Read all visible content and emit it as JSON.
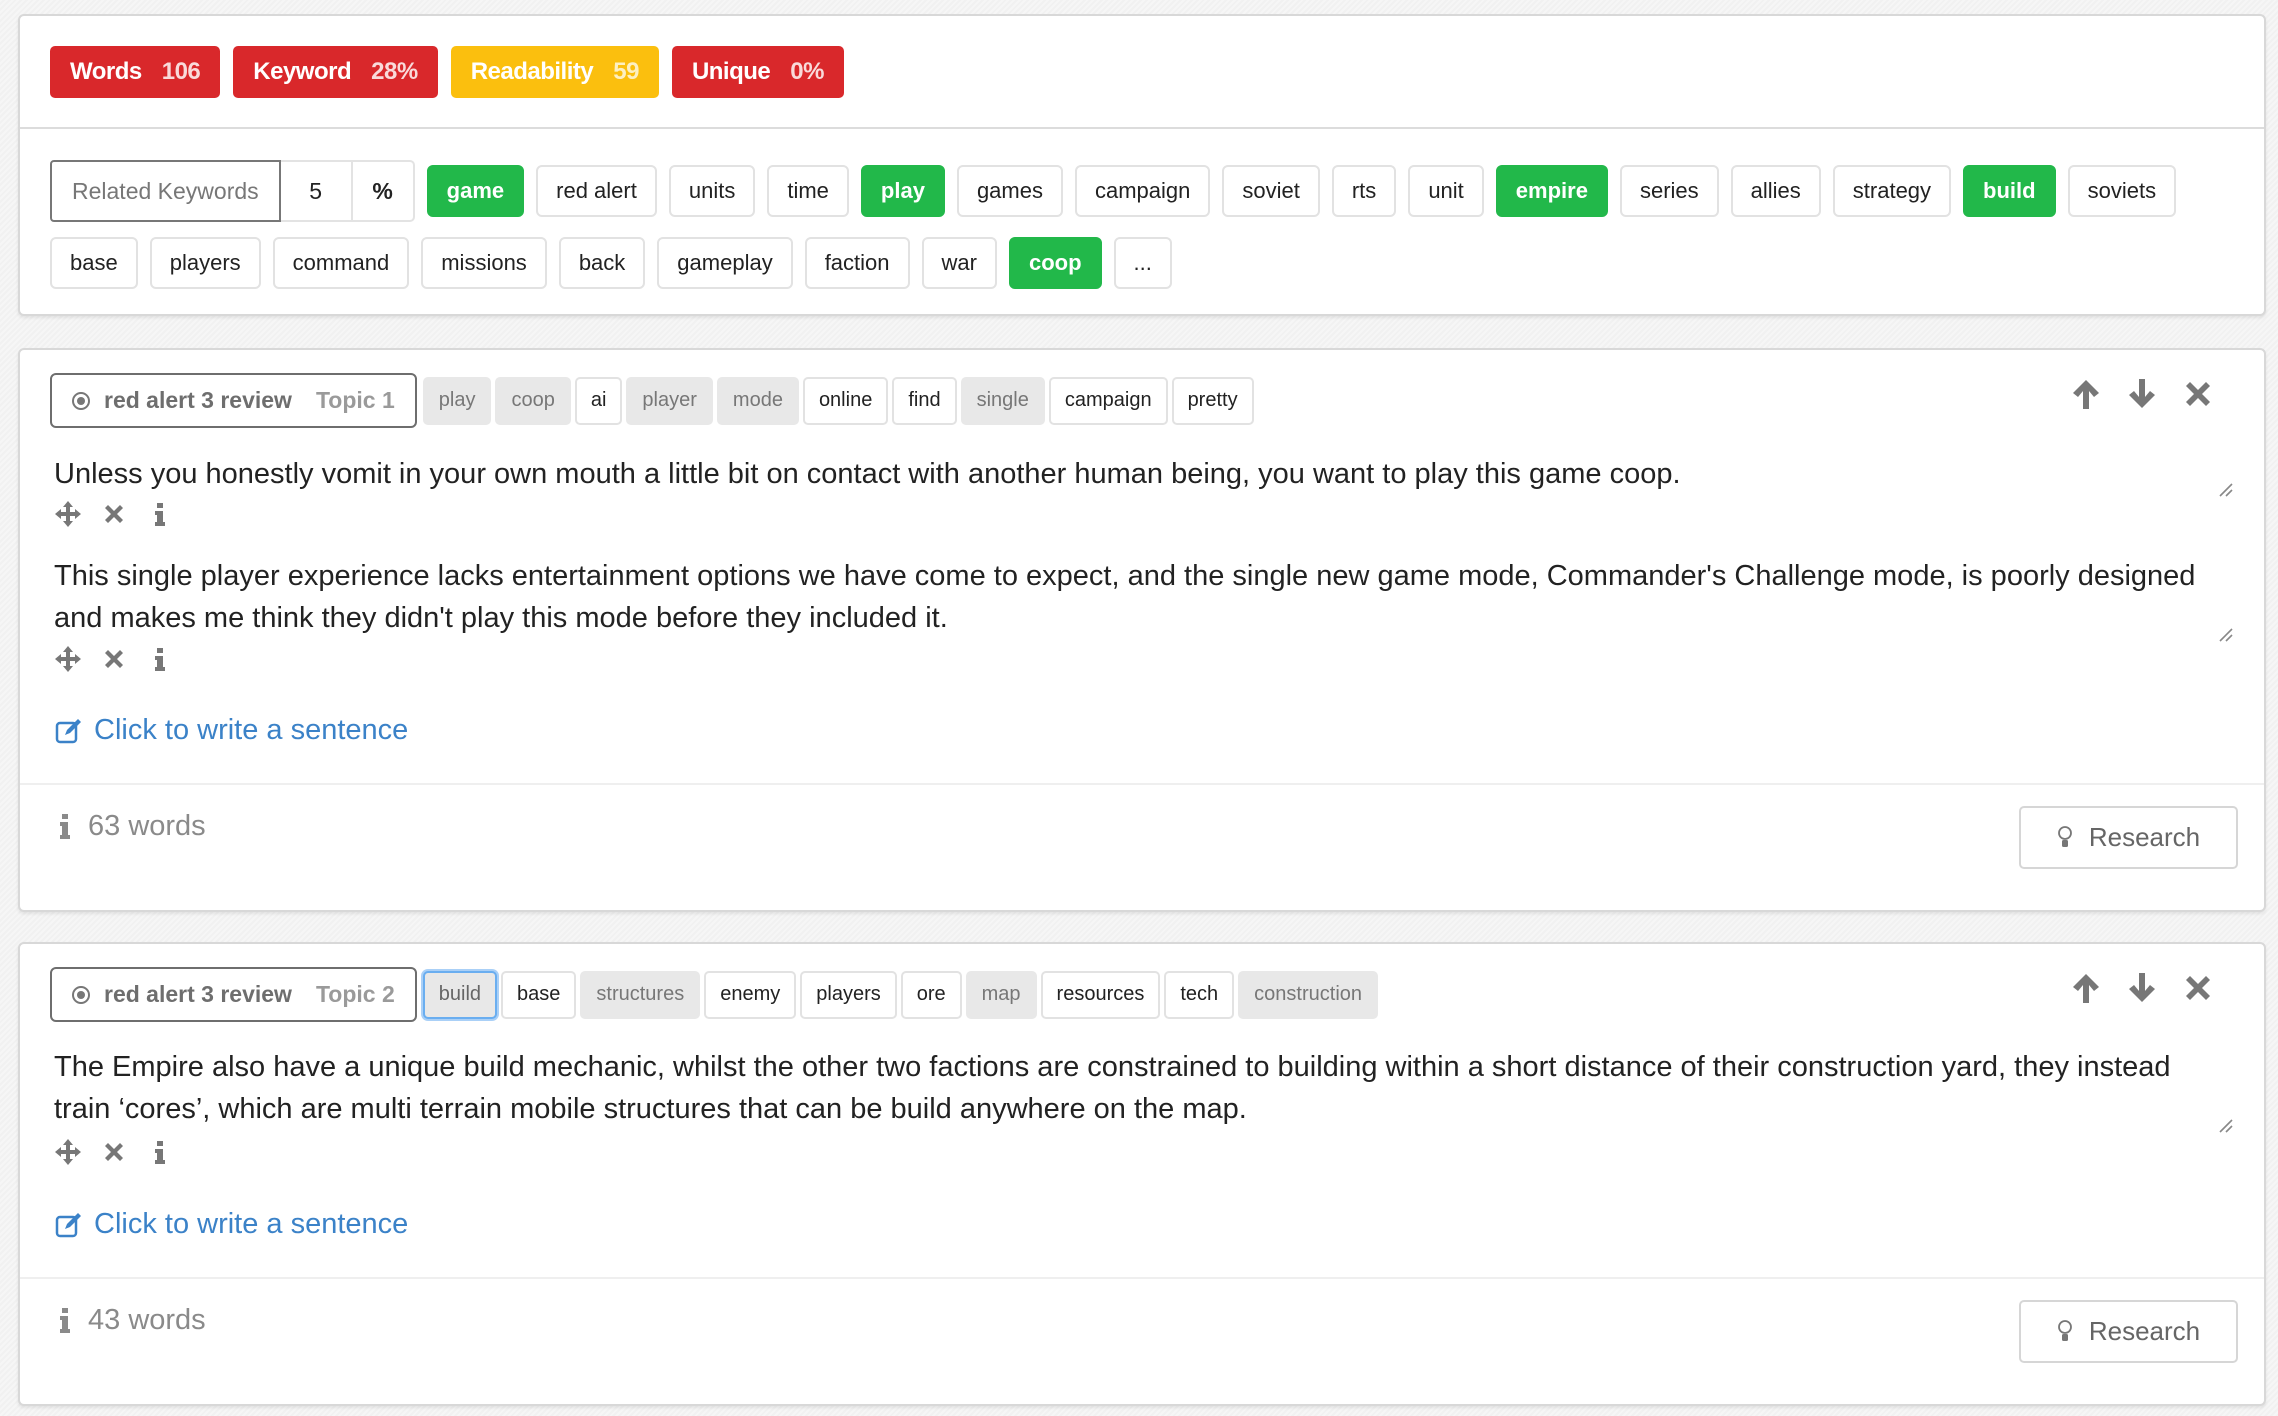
{
  "stats": {
    "badges": [
      {
        "label": "Words",
        "value": "106",
        "status": "red"
      },
      {
        "label": "Keyword",
        "value": "28%",
        "status": "red"
      },
      {
        "label": "Readability",
        "value": "59",
        "status": "yellow"
      },
      {
        "label": "Unique",
        "value": "0%",
        "status": "red"
      }
    ]
  },
  "related_keywords": {
    "label": "Related Keywords",
    "count": "5",
    "unit": "%",
    "rows": [
      [
        {
          "text": "game",
          "active": true
        },
        {
          "text": "red alert",
          "active": false
        },
        {
          "text": "units",
          "active": false
        },
        {
          "text": "time",
          "active": false
        },
        {
          "text": "play",
          "active": true
        },
        {
          "text": "games",
          "active": false
        },
        {
          "text": "campaign",
          "active": false
        },
        {
          "text": "soviet",
          "active": false
        },
        {
          "text": "rts",
          "active": false
        },
        {
          "text": "unit",
          "active": false
        },
        {
          "text": "empire",
          "active": true
        },
        {
          "text": "series",
          "active": false
        },
        {
          "text": "allies",
          "active": false
        },
        {
          "text": "strategy",
          "active": false
        },
        {
          "text": "build",
          "active": true
        },
        {
          "text": "soviets",
          "active": false
        }
      ],
      [
        {
          "text": "base",
          "active": false
        },
        {
          "text": "players",
          "active": false
        },
        {
          "text": "command",
          "active": false
        },
        {
          "text": "missions",
          "active": false
        },
        {
          "text": "back",
          "active": false
        },
        {
          "text": "gameplay",
          "active": false
        },
        {
          "text": "faction",
          "active": false
        },
        {
          "text": "war",
          "active": false
        },
        {
          "text": "coop",
          "active": true
        },
        {
          "text": "...",
          "active": false
        }
      ]
    ]
  },
  "colors": {
    "red": "#d9282b",
    "yellow": "#fbbf0e",
    "green": "#22b84a",
    "link": "#3b82c8"
  },
  "topics": [
    {
      "title": "red alert 3 review",
      "topic_label": "Topic 1",
      "keywords": [
        {
          "text": "play",
          "state": "used"
        },
        {
          "text": "coop",
          "state": "used"
        },
        {
          "text": "ai",
          "state": "unused"
        },
        {
          "text": "player",
          "state": "used"
        },
        {
          "text": "mode",
          "state": "used"
        },
        {
          "text": "online",
          "state": "unused"
        },
        {
          "text": "find",
          "state": "unused"
        },
        {
          "text": "single",
          "state": "used"
        },
        {
          "text": "campaign",
          "state": "unused"
        },
        {
          "text": "pretty",
          "state": "unused"
        }
      ],
      "sentences": [
        "Unless you honestly vomit in your own mouth a little bit on contact with another human being, you want to play this game coop.",
        "This single player experience lacks entertainment options we have come to expect, and the single new game mode, Commander's Challenge mode, is poorly designed and makes me think they didn't play this mode before they included it."
      ],
      "write_prompt": "Click to write a sentence",
      "word_count": "63 words",
      "research_label": "Research"
    },
    {
      "title": "red alert 3 review",
      "topic_label": "Topic 2",
      "keywords": [
        {
          "text": "build",
          "state": "focused"
        },
        {
          "text": "base",
          "state": "unused"
        },
        {
          "text": "structures",
          "state": "used"
        },
        {
          "text": "enemy",
          "state": "unused"
        },
        {
          "text": "players",
          "state": "unused"
        },
        {
          "text": "ore",
          "state": "unused"
        },
        {
          "text": "map",
          "state": "used"
        },
        {
          "text": "resources",
          "state": "unused"
        },
        {
          "text": "tech",
          "state": "unused"
        },
        {
          "text": "construction",
          "state": "used"
        }
      ],
      "sentences": [
        "The Empire also have a unique build mechanic, whilst the other two factions are constrained to building within a short distance of their construction yard, they instead train ‘cores’, which are multi terrain mobile structures that can be build anywhere on the map."
      ],
      "write_prompt": "Click to write a sentence",
      "word_count": "43 words",
      "research_label": "Research"
    }
  ]
}
